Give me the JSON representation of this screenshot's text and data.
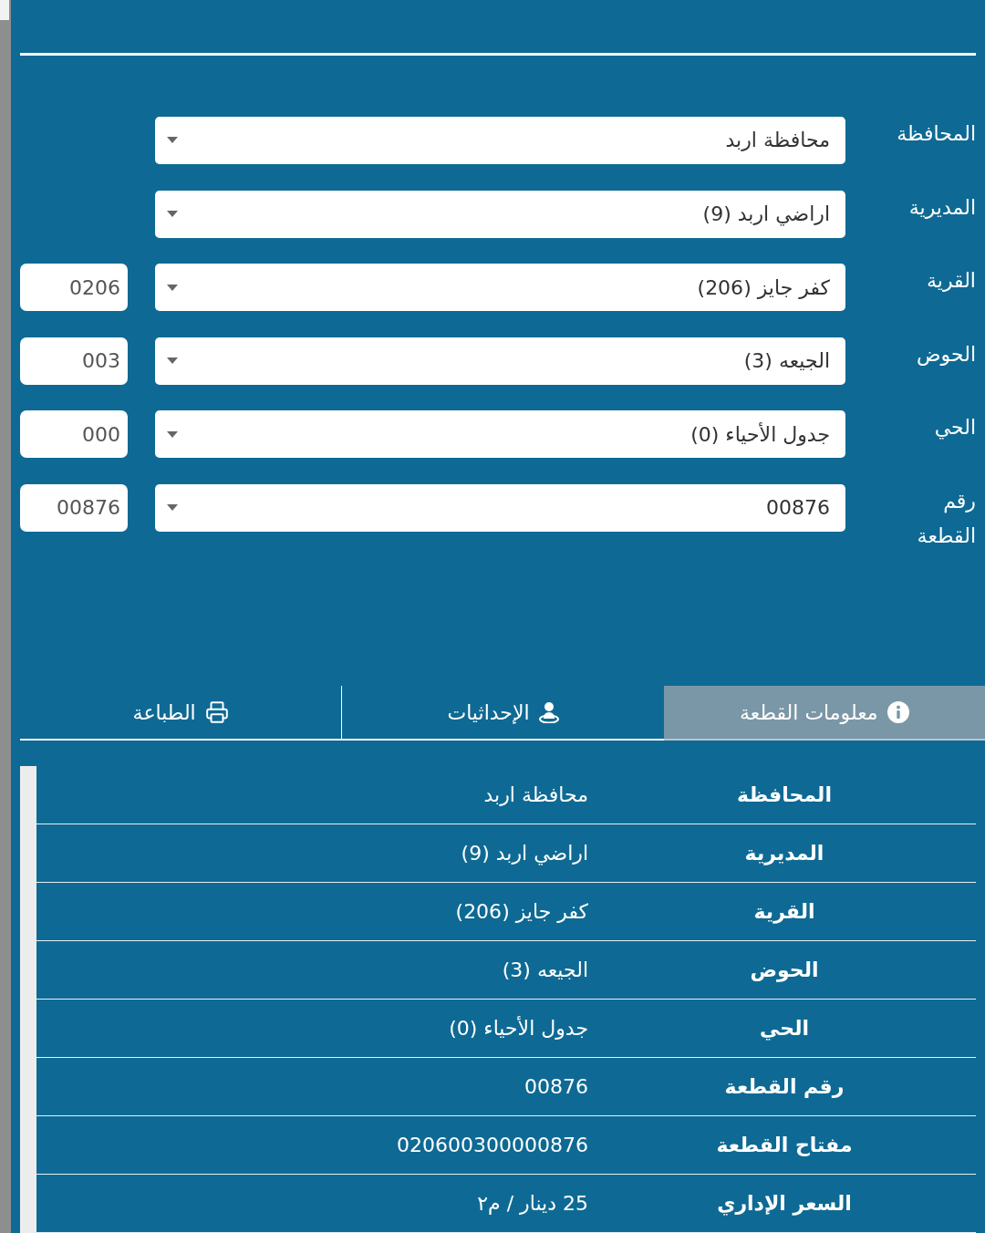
{
  "location_form": [
    {
      "label": "المحافظة",
      "value": "محافظة اربد"
    },
    {
      "label": "المديرية",
      "value": "اراضي اربد (9)"
    },
    {
      "label": "القرية",
      "value": "كفر جايز (206)",
      "code": "0206"
    },
    {
      "label": "الحوض",
      "value": "الجيعه (3)",
      "code": "003"
    },
    {
      "label": "الحي",
      "value": "جدول الأحياء (0)",
      "code": "000"
    },
    {
      "label": "رقم القطعة",
      "value": "00876",
      "code": "00876"
    }
  ],
  "tabs": [
    {
      "label": "معلومات القطعة",
      "selected": true
    },
    {
      "label": "الإحداثيات",
      "selected": false
    },
    {
      "label": "الطباعة",
      "selected": false
    }
  ],
  "parcel_info": [
    {
      "label": "المحافظة",
      "value": "محافظة اربد"
    },
    {
      "label": "المديرية",
      "value": "اراضي اربد (9)"
    },
    {
      "label": "القرية",
      "value": "كفر جايز (206)"
    },
    {
      "label": "الحوض",
      "value": "الجيعه (3)"
    },
    {
      "label": "الحي",
      "value": "جدول الأحياء (0)"
    },
    {
      "label": "رقم القطعة",
      "value": "00876"
    },
    {
      "label": "مفتاح القطعة",
      "value": "020600300000876"
    },
    {
      "label": "السعر الإداري",
      "value": "25 دينار / م٢"
    }
  ]
}
